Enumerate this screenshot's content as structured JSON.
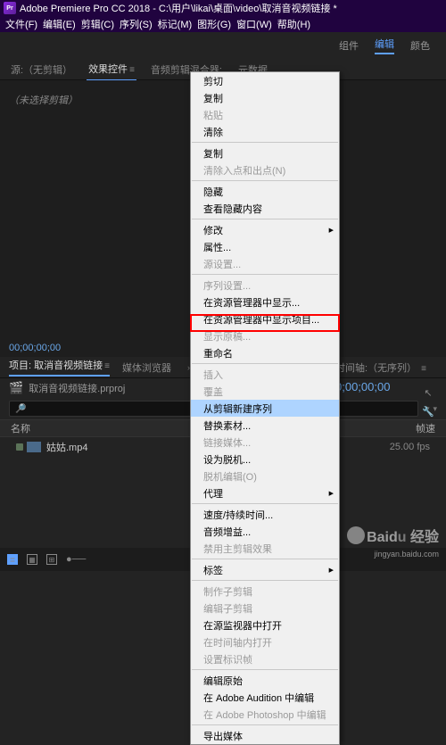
{
  "titlebar": {
    "app": "Adobe Premiere Pro CC 2018",
    "path": "C:\\用户\\likai\\桌面\\video\\取消音视频链接 *"
  },
  "menubar": [
    "文件(F)",
    "编辑(E)",
    "剪辑(C)",
    "序列(S)",
    "标记(M)",
    "图形(G)",
    "窗口(W)",
    "帮助(H)"
  ],
  "workspace": {
    "tabs": [
      "组件",
      "编辑",
      "颜色"
    ],
    "active": 1
  },
  "sourcePanel": {
    "tabs": [
      "源:（无剪辑）",
      "效果控件",
      "音频剪辑混合器:",
      "元数据"
    ],
    "activeIdx": 1,
    "noClip": "（未选择剪辑）",
    "tc": "00;00;00;00"
  },
  "projectPanel": {
    "tabs": [
      "项目: 取消音视频链接",
      "媒体浏览器"
    ],
    "activeIdx": 0,
    "filename": "取消音视频链接.prproj",
    "searchPlaceholder": "",
    "headers": {
      "name": "名称",
      "fps": "帧速"
    },
    "clip": {
      "name": "姑姑.mp4",
      "fps": "25.00 fps"
    }
  },
  "timelinePanel": {
    "label": "时间轴:（无序列）",
    "tc": "0;00;00;00"
  },
  "contextMenu": [
    {
      "label": "剪切"
    },
    {
      "label": "复制"
    },
    {
      "label": "粘贴",
      "disabled": true
    },
    {
      "label": "清除"
    },
    {
      "sep": true
    },
    {
      "label": "复制"
    },
    {
      "label": "清除入点和出点(N)",
      "disabled": true
    },
    {
      "sep": true
    },
    {
      "label": "隐藏"
    },
    {
      "label": "查看隐藏内容"
    },
    {
      "sep": true
    },
    {
      "label": "修改",
      "sub": true
    },
    {
      "label": "属性..."
    },
    {
      "label": "源设置...",
      "disabled": true
    },
    {
      "sep": true
    },
    {
      "label": "序列设置...",
      "disabled": true
    },
    {
      "label": "在资源管理器中显示..."
    },
    {
      "label": "在资源管理器中显示项目..."
    },
    {
      "label": "显示原稿...",
      "disabled": true
    },
    {
      "label": "重命名"
    },
    {
      "sep": true
    },
    {
      "label": "插入",
      "disabled": true
    },
    {
      "label": "覆盖",
      "disabled": true
    },
    {
      "label": "从剪辑新建序列",
      "highlighted": true
    },
    {
      "label": "替换素材..."
    },
    {
      "label": "链接媒体...",
      "disabled": true
    },
    {
      "label": "设为脱机..."
    },
    {
      "label": "脱机编辑(O)",
      "disabled": true
    },
    {
      "label": "代理",
      "sub": true
    },
    {
      "sep": true
    },
    {
      "label": "速度/持续时间..."
    },
    {
      "label": "音频增益..."
    },
    {
      "label": "禁用主剪辑效果",
      "disabled": true
    },
    {
      "sep": true
    },
    {
      "label": "标签",
      "sub": true
    },
    {
      "sep": true
    },
    {
      "label": "制作子剪辑",
      "disabled": true
    },
    {
      "label": "编辑子剪辑",
      "disabled": true
    },
    {
      "label": "在源监视器中打开"
    },
    {
      "label": "在时间轴内打开",
      "disabled": true
    },
    {
      "label": "设置标识帧",
      "disabled": true
    },
    {
      "sep": true
    },
    {
      "label": "编辑原始"
    },
    {
      "label": "在 Adobe Audition 中编辑"
    },
    {
      "label": "在 Adobe Photoshop 中编辑",
      "disabled": true
    },
    {
      "sep": true
    },
    {
      "label": "导出媒体"
    }
  ],
  "watermark": {
    "brand": "Bai",
    "suffix": "经验",
    "domain": "jingyan.baidu.com"
  }
}
